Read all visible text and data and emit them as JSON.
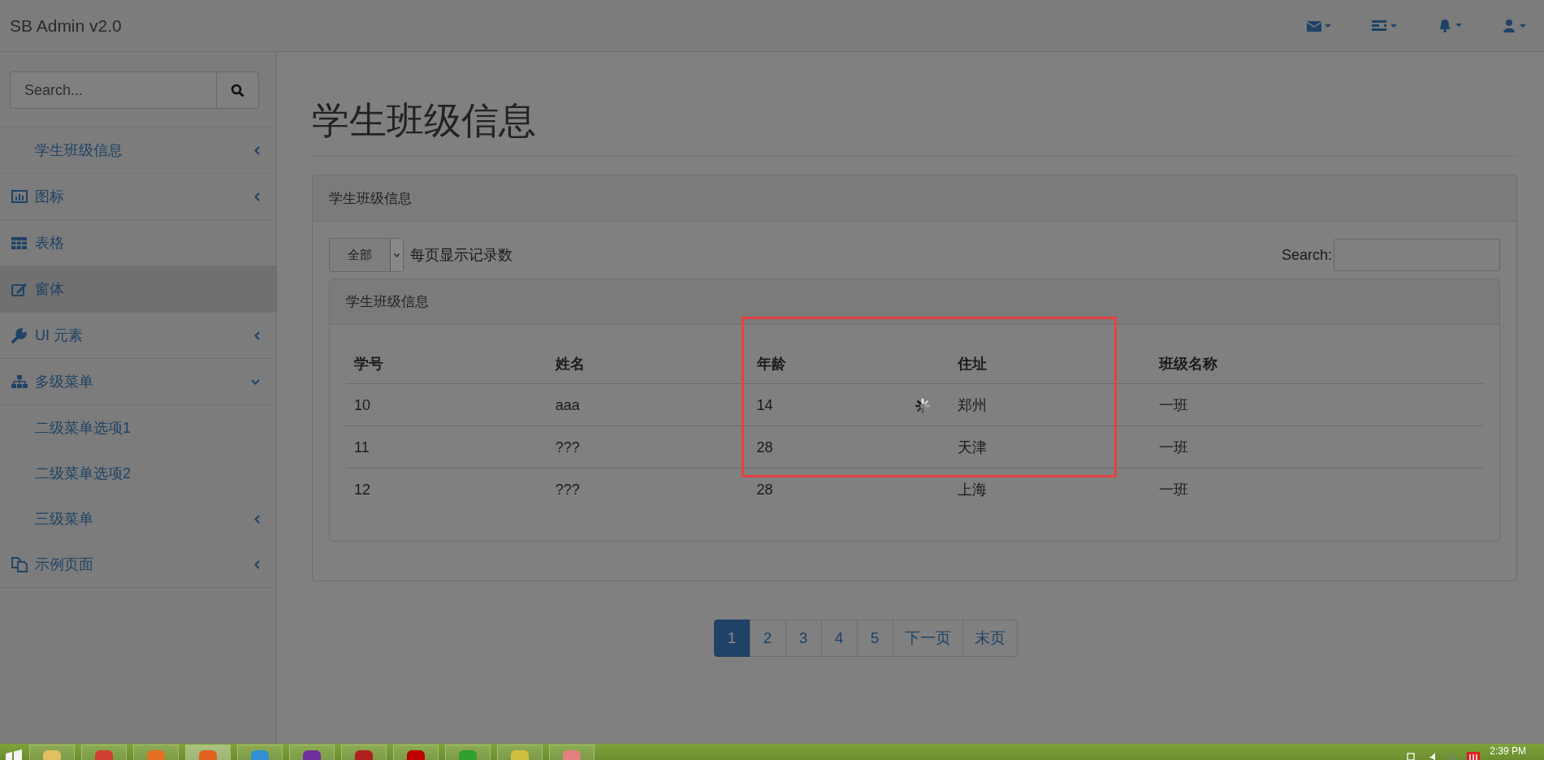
{
  "navbar": {
    "brand": "SB Admin v2.0"
  },
  "sidebar": {
    "search": {
      "placeholder": "Search..."
    },
    "items": [
      {
        "label": "学生班级信息",
        "selected": false,
        "expanded": false
      },
      {
        "label": "图标",
        "selected": false,
        "expanded": false
      },
      {
        "label": "表格",
        "selected": false
      },
      {
        "label": "窗体",
        "selected": true
      },
      {
        "label": "UI 元素",
        "selected": false,
        "expanded": false
      },
      {
        "label": "多级菜单",
        "selected": false,
        "expanded": true,
        "children": [
          {
            "label": "二级菜单选项1",
            "selected": false
          },
          {
            "label": "二级菜单选项2",
            "selected": false
          },
          {
            "label": "三级菜单",
            "selected": false,
            "expanded": false
          }
        ]
      },
      {
        "label": "示例页面",
        "selected": false,
        "expanded": false
      }
    ]
  },
  "page": {
    "title": "学生班级信息"
  },
  "panel": {
    "title": "学生班级信息",
    "length_select": {
      "value": "全部"
    },
    "length_label": "每页显示记录数",
    "search_label": "Search:",
    "table_panel": {
      "title": "学生班级信息",
      "columns": [
        "学号",
        "姓名",
        "年龄",
        "住址",
        "班级名称"
      ],
      "rows": [
        [
          "10",
          "aaa",
          "14",
          "郑州",
          "一班"
        ],
        [
          "11",
          "???",
          "28",
          "天津",
          "一班"
        ],
        [
          "12",
          "???",
          "28",
          "上海",
          "一班"
        ]
      ]
    }
  },
  "pagination": [
    {
      "label": "1",
      "selected": true
    },
    {
      "label": "2",
      "selected": false
    },
    {
      "label": "3",
      "selected": false
    },
    {
      "label": "4",
      "selected": false
    },
    {
      "label": "5",
      "selected": false
    },
    {
      "label": "下一页",
      "selected": false
    },
    {
      "label": "末页",
      "selected": false
    }
  ],
  "taskbar": {
    "clock": "2:39 PM"
  }
}
